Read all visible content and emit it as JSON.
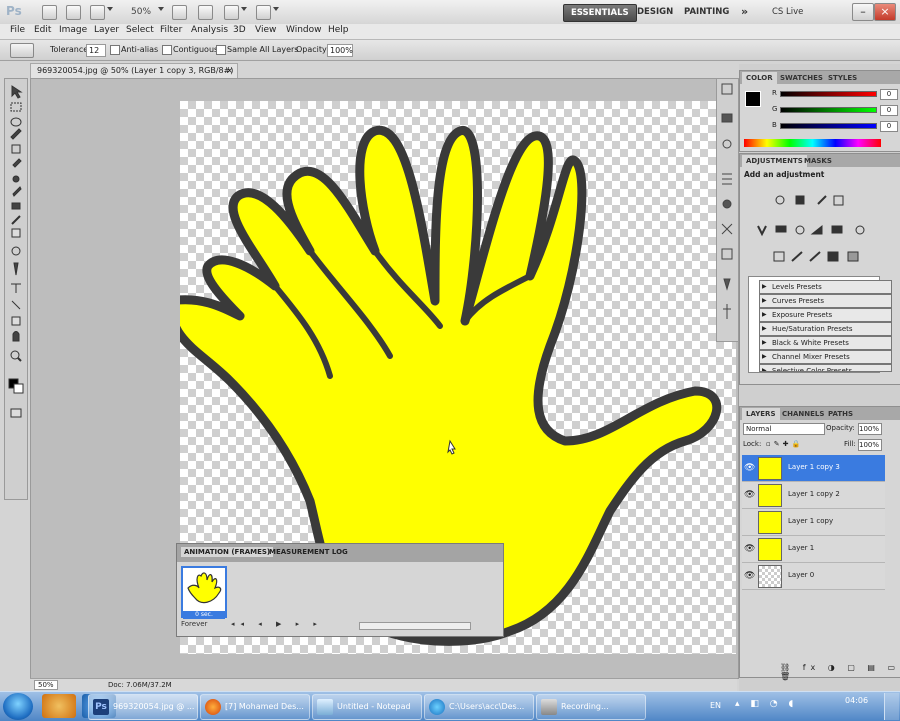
{
  "app": {
    "logo": "Ps",
    "zoom": "50%"
  },
  "workspace": {
    "essentials": "ESSENTIALS",
    "design": "DESIGN",
    "painting": "PAINTING",
    "more": "»",
    "cs_live": "CS Live"
  },
  "menu": [
    "File",
    "Edit",
    "Image",
    "Layer",
    "Select",
    "Filter",
    "Analysis",
    "3D",
    "View",
    "Window",
    "Help"
  ],
  "options": {
    "tolerance_label": "Tolerance:",
    "tolerance_value": "12",
    "antialias": "Anti-alias",
    "contiguous": "Contiguous",
    "sample_all": "Sample All Layers",
    "opacity_label": "Opacity:",
    "opacity_value": "100%"
  },
  "document": {
    "tab_title": "969320054.jpg @ 50% (Layer 1 copy 3, RGB/8#)",
    "zoom_status": "50%",
    "doc_info": "Doc: 7.06M/37.2M"
  },
  "animation": {
    "tab_frames": "ANIMATION (FRAMES)",
    "tab_measure": "MEASUREMENT LOG",
    "frame_time": "0 sec.",
    "loop": "Forever"
  },
  "color_panel": {
    "tabs": [
      "COLOR",
      "SWATCHES",
      "STYLES"
    ],
    "r": "0",
    "g": "0",
    "b": "0",
    "labels": [
      "R",
      "G",
      "B"
    ]
  },
  "adjust_panel": {
    "tabs": [
      "ADJUSTMENTS",
      "MASKS"
    ],
    "heading": "Add an adjustment",
    "presets": [
      "Levels Presets",
      "Curves Presets",
      "Exposure Presets",
      "Hue/Saturation Presets",
      "Black & White Presets",
      "Channel Mixer Presets",
      "Selective Color Presets"
    ]
  },
  "layers_panel": {
    "tabs": [
      "LAYERS",
      "CHANNELS",
      "PATHS"
    ],
    "blend": "Normal",
    "opacity_label": "Opacity:",
    "opacity": "100%",
    "lock_label": "Lock:",
    "fill_label": "Fill:",
    "fill": "100%",
    "layers": [
      {
        "name": "Layer 1 copy 3",
        "selected": true
      },
      {
        "name": "Layer 1 copy 2",
        "selected": false
      },
      {
        "name": "Layer 1 copy",
        "selected": false
      },
      {
        "name": "Layer 1",
        "selected": false
      },
      {
        "name": "Layer 0",
        "selected": false
      }
    ]
  },
  "taskbar": {
    "tasks": [
      "969320054.jpg @ ...",
      "[7] Mohamed Des...",
      "Untitled - Notepad",
      "C:\\Users\\acc\\Des...",
      "Recording..."
    ],
    "lang": "EN",
    "time": "04:06"
  },
  "colors": {
    "accent": "#3a7be0",
    "hand_fill": "#ffff00",
    "hand_outline": "#3a3a3a",
    "taskbar": "#4f86c6"
  }
}
